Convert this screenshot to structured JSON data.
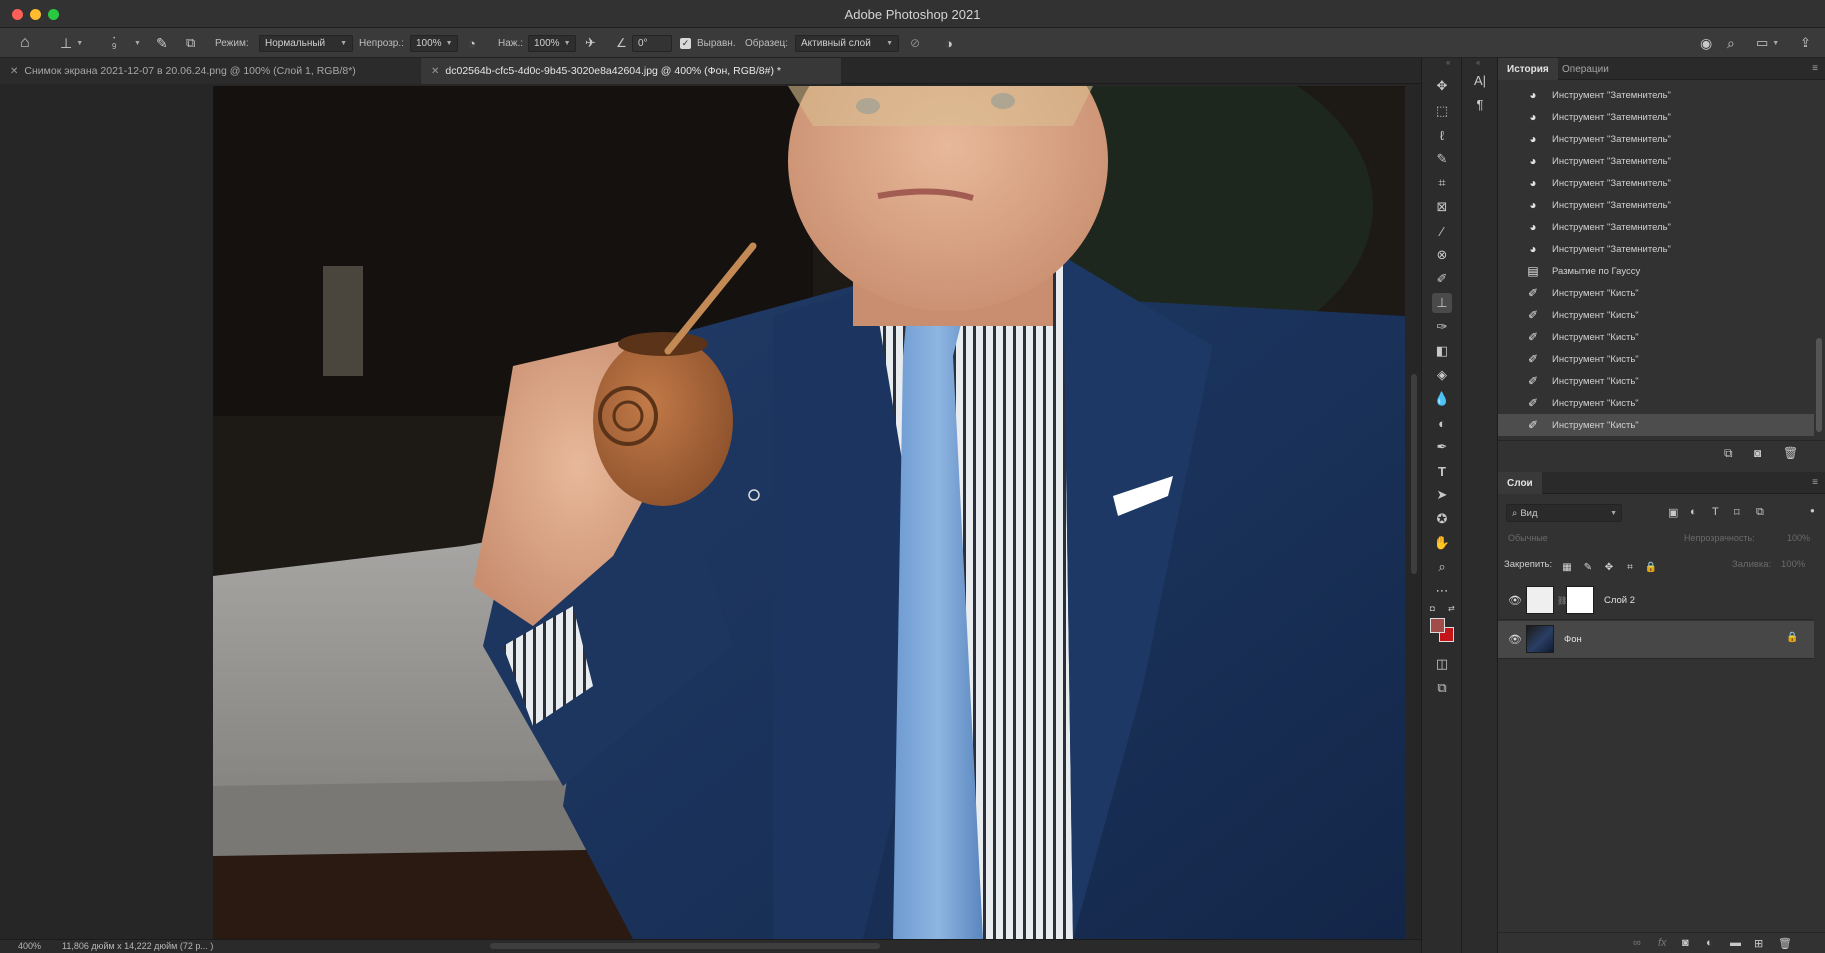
{
  "window": {
    "title": "Adobe Photoshop 2021"
  },
  "options": {
    "mode_label": "Режим:",
    "mode_value": "Нормальный",
    "opacity_label": "Непрозр.:",
    "opacity_value": "100%",
    "pressure_label": "Наж.:",
    "pressure_value": "100%",
    "angle_value": "0°",
    "align_label": "Выравн.",
    "sample_label": "Образец:",
    "sample_value": "Активный слой",
    "brush_size": "9"
  },
  "tabs": [
    {
      "label": "Снимок экрана 2021-12-07 в 20.06.24.png @ 100% (Слой 1, RGB/8*)",
      "active": false
    },
    {
      "label": "dc02564b-cfc5-4d0c-9b45-3020e8a42604.jpg @ 400% (Фон, RGB/8#) *",
      "active": true
    }
  ],
  "status": {
    "zoom": "400%",
    "doc_size": "11,806 дюйм x 14,222 дюйм (72 р... )"
  },
  "history_panel": {
    "tabs": [
      "История",
      "Операции"
    ],
    "items": [
      {
        "icon": "burn-tool-icon",
        "label": "Инструмент \"Затемнитель\""
      },
      {
        "icon": "burn-tool-icon",
        "label": "Инструмент \"Затемнитель\""
      },
      {
        "icon": "burn-tool-icon",
        "label": "Инструмент \"Затемнитель\""
      },
      {
        "icon": "burn-tool-icon",
        "label": "Инструмент \"Затемнитель\""
      },
      {
        "icon": "burn-tool-icon",
        "label": "Инструмент \"Затемнитель\""
      },
      {
        "icon": "burn-tool-icon",
        "label": "Инструмент \"Затемнитель\""
      },
      {
        "icon": "burn-tool-icon",
        "label": "Инструмент \"Затемнитель\""
      },
      {
        "icon": "burn-tool-icon",
        "label": "Инструмент \"Затемнитель\""
      },
      {
        "icon": "filter-icon",
        "label": "Размытие по Гауссу"
      },
      {
        "icon": "brush-icon",
        "label": "Инструмент \"Кисть\""
      },
      {
        "icon": "brush-icon",
        "label": "Инструмент \"Кисть\""
      },
      {
        "icon": "brush-icon",
        "label": "Инструмент \"Кисть\""
      },
      {
        "icon": "brush-icon",
        "label": "Инструмент \"Кисть\""
      },
      {
        "icon": "brush-icon",
        "label": "Инструмент \"Кисть\""
      },
      {
        "icon": "brush-icon",
        "label": "Инструмент \"Кисть\""
      },
      {
        "icon": "brush-icon",
        "label": "Инструмент \"Кисть\""
      }
    ],
    "selected_index": 15
  },
  "layers_panel": {
    "title": "Слои",
    "filter_kind": "Вид",
    "blend_mode": "Обычные",
    "opacity_label": "Непрозрачность:",
    "opacity_value": "100%",
    "lock_label": "Закрепить:",
    "fill_label": "Заливка:",
    "fill_value": "100%",
    "layers": [
      {
        "name": "Слой 2",
        "visible": true,
        "has_mask": true,
        "selected": false
      },
      {
        "name": "Фон",
        "visible": true,
        "locked": true,
        "selected": true
      }
    ]
  },
  "colors": {
    "foreground": "#a24b4b",
    "background": "#c5151b",
    "accent_close": "#fe5f57",
    "accent_min": "#febc2e",
    "accent_max": "#28c840"
  }
}
